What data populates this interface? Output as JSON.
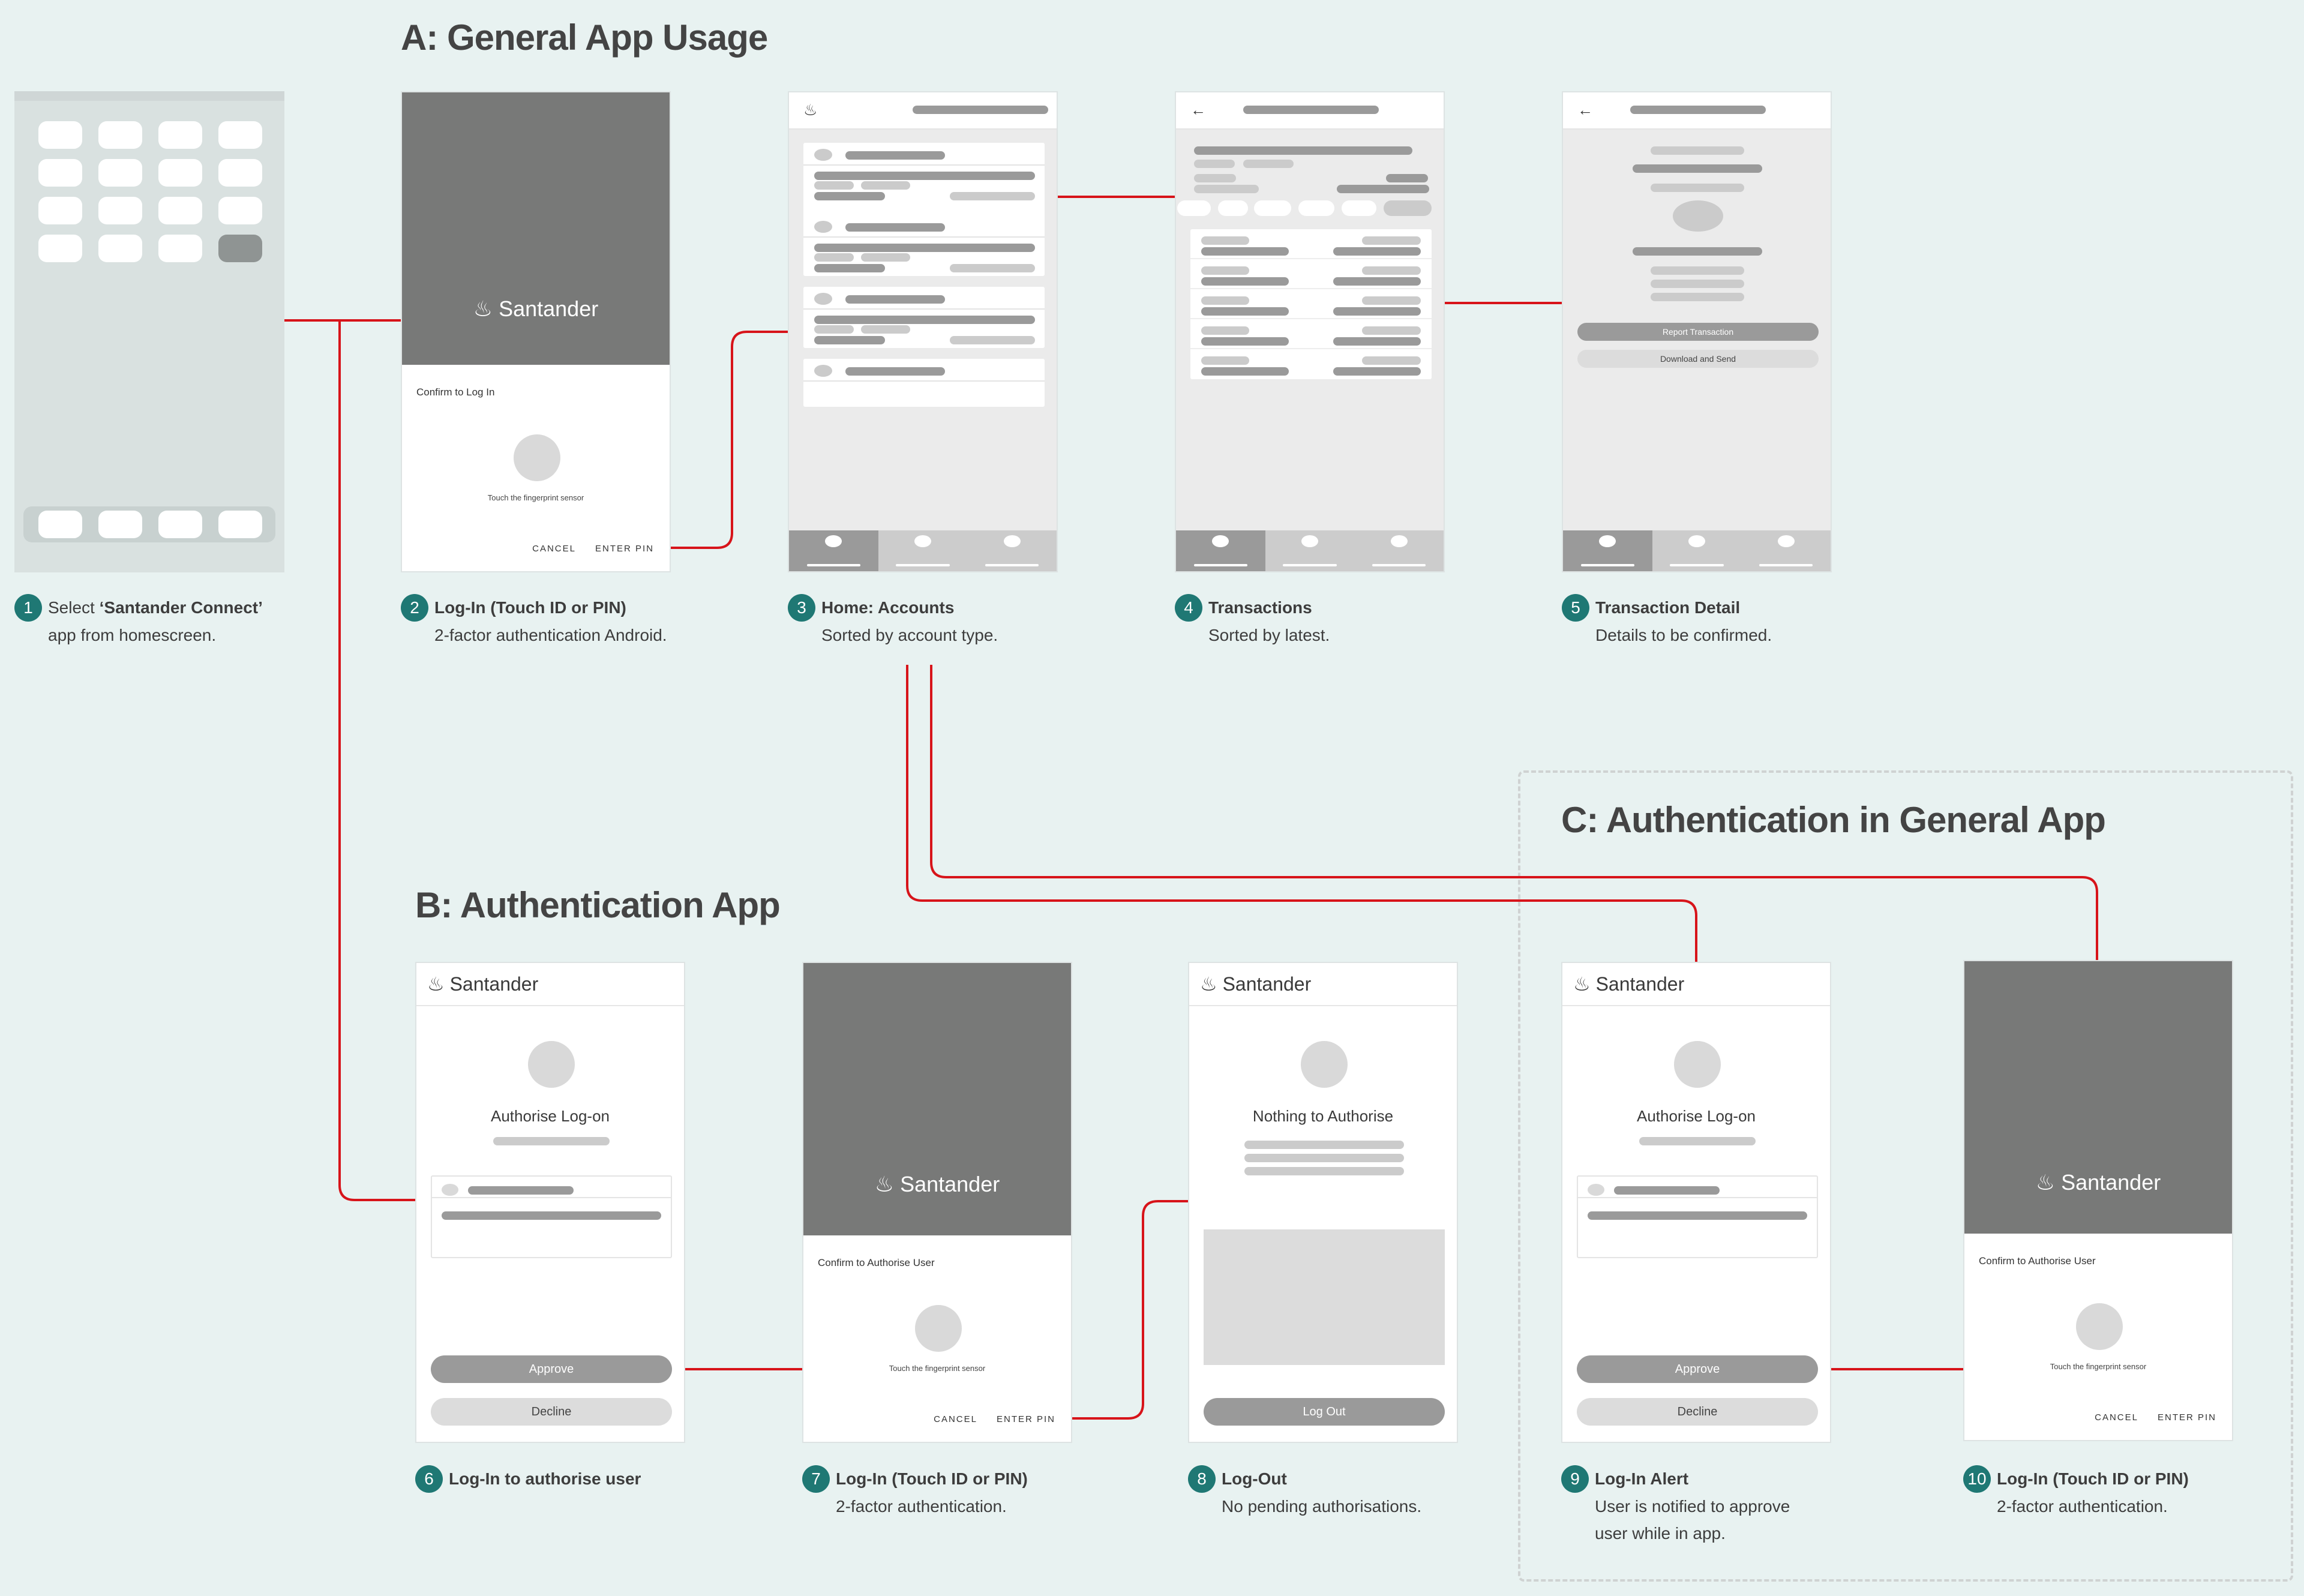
{
  "sections": {
    "a": "A: General App Usage",
    "b": "B: Authentication App",
    "c": "C: Authentication in General App"
  },
  "brand": {
    "name": "Santander",
    "connector_color": "#d7141a",
    "badge_color": "#1f7874"
  },
  "screens": {
    "s2": {
      "dialog_title": "Confirm to Log In",
      "hint": "Touch the fingerprint sensor",
      "cancel": "CANCEL",
      "enter_pin": "ENTER PIN"
    },
    "s5": {
      "report": "Report Transaction",
      "download": "Download and Send"
    },
    "s6": {
      "title": "Authorise Log-on",
      "approve": "Approve",
      "decline": "Decline"
    },
    "s7": {
      "dialog_title": "Confirm to Authorise User",
      "hint": "Touch the fingerprint sensor",
      "cancel": "CANCEL",
      "enter_pin": "ENTER PIN"
    },
    "s8": {
      "title": "Nothing to Authorise",
      "logout": "Log Out"
    },
    "s9": {
      "title": "Authorise Log-on",
      "approve": "Approve",
      "decline": "Decline"
    },
    "s10": {
      "dialog_title": "Confirm to Authorise User",
      "hint": "Touch the fingerprint sensor",
      "cancel": "CANCEL",
      "enter_pin": "ENTER PIN"
    }
  },
  "captions": [
    {
      "num": "1",
      "pre": "Select ",
      "title": "‘Santander Connect’",
      "sub": "app from homescreen."
    },
    {
      "num": "2",
      "title": "Log-In (Touch ID or PIN)",
      "sub": "2-factor authentication Android."
    },
    {
      "num": "3",
      "title": "Home: Accounts",
      "sub": "Sorted by account type."
    },
    {
      "num": "4",
      "title": "Transactions",
      "sub": "Sorted by latest."
    },
    {
      "num": "5",
      "title": "Transaction Detail",
      "sub": "Details to be confirmed."
    },
    {
      "num": "6",
      "title": "Log-In to authorise user",
      "sub": ""
    },
    {
      "num": "7",
      "title": "Log-In (Touch ID or PIN)",
      "sub": "2-factor authentication."
    },
    {
      "num": "8",
      "title": "Log-Out",
      "sub": "No pending authorisations."
    },
    {
      "num": "9",
      "title": "Log-In Alert",
      "sub": "User is notified to approve user while in app."
    },
    {
      "num": "10",
      "title": "Log-In (Touch ID or PIN)",
      "sub": "2-factor authentication."
    }
  ]
}
